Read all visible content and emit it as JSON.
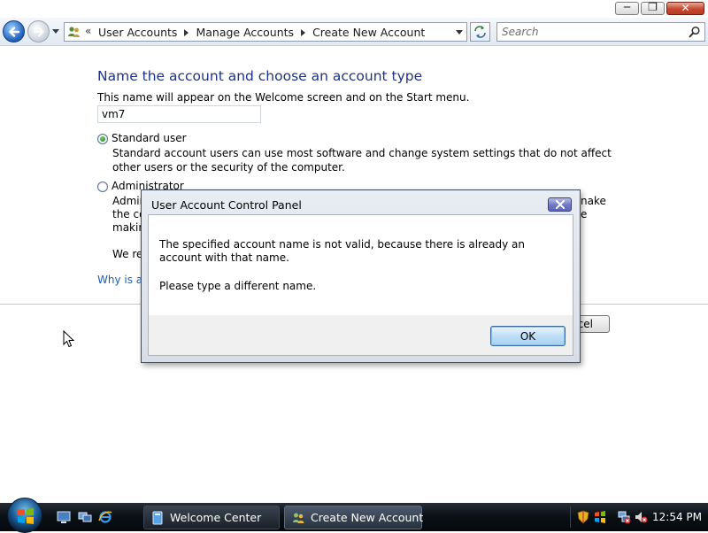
{
  "window": {
    "minimize_glyph": "─",
    "maximize_glyph": "❐",
    "close_glyph": "✕"
  },
  "navbar": {
    "address_prefix": "«",
    "breadcrumbs": [
      "User Accounts",
      "Manage Accounts",
      "Create New Account"
    ],
    "search_placeholder": "Search"
  },
  "main": {
    "title": "Name the account and choose an account type",
    "description": "This name will appear on the Welcome screen and on the Start menu.",
    "name_value": "vm7",
    "standard": {
      "label": "Standard user",
      "description": "Standard account users can use most software and change system settings that do not affect other users or the security of the computer."
    },
    "administrator": {
      "label": "Administrator",
      "desc_line1_visible": "Admin",
      "desc_line1_tail": "nake",
      "desc_line2_visible": "the co",
      "desc_line2_tail": "e",
      "desc_line3_visible": "makin"
    },
    "recommend_visible": "We rec",
    "why_link_visible": "Why is a s",
    "cancel_visible": "cel"
  },
  "dialog": {
    "title": "User Account Control Panel",
    "message": "The specified account name is not valid, because there is already an account with that name.",
    "message2": "Please type a different name.",
    "ok_label": "OK"
  },
  "taskbar": {
    "buttons": [
      {
        "label": "Welcome Center",
        "active": false
      },
      {
        "label": "Create New Account",
        "active": true
      }
    ],
    "clock": "12:54 PM"
  },
  "colors": {
    "title_blue": "#1e3287",
    "link_blue": "#1b5fbd",
    "taskbar": "#0c1116"
  }
}
